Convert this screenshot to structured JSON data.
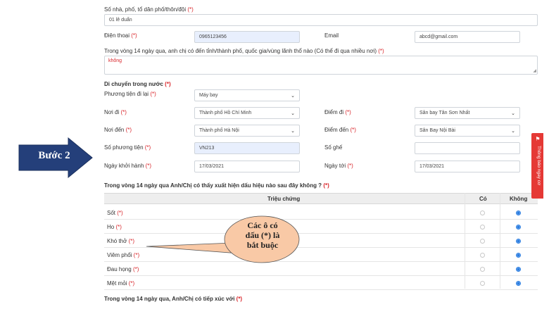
{
  "address": {
    "label": "Số nhà, phố, tổ dân phố/thôn/đội",
    "value": "01 lê duẩn"
  },
  "phone": {
    "label": "Điện thoại",
    "value": "0965123456"
  },
  "email": {
    "label": "Email",
    "value": "abcd@gmail.com"
  },
  "travel_question": {
    "label": "Trong vòng 14 ngày qua, anh chị có đến tỉnh/thành phố, quốc gia/vùng lãnh thổ nào (Có thể đi qua nhiều nơi)",
    "value": "không"
  },
  "domestic": {
    "heading": "Di chuyển trong nước",
    "vehicle": {
      "label": "Phương tiện đi lại",
      "value": "Máy bay"
    },
    "from": {
      "label": "Nơi đi",
      "value": "Thành phố Hồ Chí Minh"
    },
    "depart_point": {
      "label": "Điểm đi",
      "value": "Sân bay Tân Sơn Nhất"
    },
    "to": {
      "label": "Nơi đến",
      "value": "Thành phố Hà Nội"
    },
    "arrive_point": {
      "label": "Điểm đến",
      "value": "Sân Bay Nội Bài"
    },
    "vehicle_no": {
      "label": "Số phương tiện",
      "value": "VN213"
    },
    "seat": {
      "label": "Số ghế",
      "value": ""
    },
    "depart_date": {
      "label": "Ngày khởi hành",
      "value": "17/03/2021"
    },
    "arrive_date": {
      "label": "Ngày tới",
      "value": "17/03/2021"
    }
  },
  "required_mark": "(*)",
  "symptoms": {
    "question": "Trong vòng 14 ngày qua Anh/Chị có thấy xuất hiện dấu hiệu nào sau đây không ?",
    "col_symptom": "Triệu chứng",
    "col_yes": "Có",
    "col_no": "Không",
    "rows": [
      {
        "name": "Sốt",
        "answer": "no"
      },
      {
        "name": "Ho",
        "answer": "no"
      },
      {
        "name": "Khó thở",
        "answer": "no"
      },
      {
        "name": "Viêm phổi",
        "answer": "no"
      },
      {
        "name": "Đau họng",
        "answer": "no"
      },
      {
        "name": "Mệt mỏi",
        "answer": "no"
      }
    ]
  },
  "contact_question": "Trong vòng 14 ngày qua, Anh/Chị có tiếp xúc với",
  "annotations": {
    "step": "Bước 2",
    "callout_line1": "Các ô có",
    "callout_line2": "dấu (*) là",
    "callout_line3": "bắt buộc"
  },
  "feedback_tab": {
    "label": "Thông báo ngay cơ",
    "icon": "flag-icon"
  },
  "colors": {
    "required": "#d9262b",
    "highlight": "#e8effd",
    "arrow": "#243f7a",
    "callout": "#f9c9a6",
    "tab": "#e53935",
    "radio": "#2a7de1"
  }
}
